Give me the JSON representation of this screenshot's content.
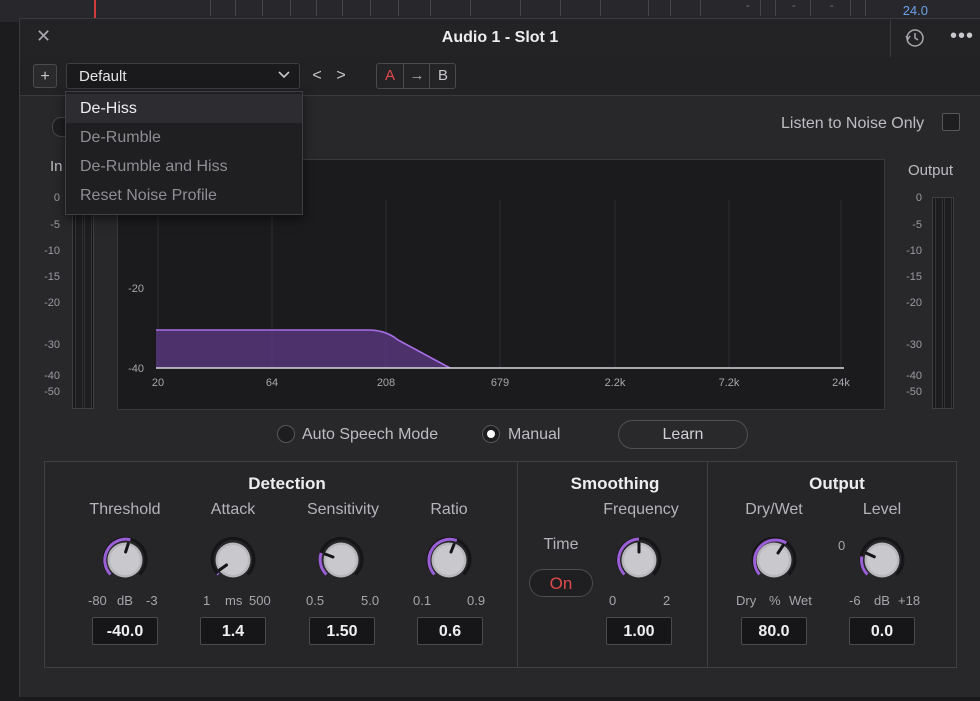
{
  "timeline": {
    "value": "24.0",
    "dashes": [
      "-",
      "-",
      "-"
    ]
  },
  "window": {
    "title": "Audio 1 - Slot 1"
  },
  "toolbar": {
    "add_label": "+",
    "preset": "Default",
    "prev": "<",
    "next": ">",
    "a_label": "A",
    "copy_arrow": "→",
    "b_label": "B"
  },
  "dropdown": {
    "items": [
      "De-Hiss",
      "De-Rumble",
      "De-Rumble and Hiss",
      "Reset Noise Profile"
    ],
    "selected_index": 0
  },
  "input": {
    "label": "In",
    "scale": [
      "0",
      "-5",
      "-10",
      "-15",
      "-20",
      "-30",
      "-40",
      "-50"
    ]
  },
  "output_meter": {
    "label": "Output",
    "scale": [
      "0",
      "-5",
      "-10",
      "-15",
      "-20",
      "-30",
      "-40",
      "-50"
    ]
  },
  "listen": {
    "label": "Listen to Noise Only",
    "checked": false
  },
  "graph": {
    "y_labels": [
      "-20",
      "-40"
    ],
    "x_labels": [
      "20",
      "64",
      "208",
      "679",
      "2.2k",
      "7.2k",
      "24k"
    ],
    "curve_color": "#9a5fd6"
  },
  "mode": {
    "auto_label": "Auto Speech Mode",
    "manual_label": "Manual",
    "selected": "Manual",
    "learn_label": "Learn"
  },
  "accent_color": "#9a5fd6",
  "toggle_on_color": "#e04a4a",
  "detection": {
    "title": "Detection",
    "threshold": {
      "label": "Threshold",
      "min": "-80",
      "unit": "dB",
      "max": "-3",
      "value": "-40.0"
    },
    "attack": {
      "label": "Attack",
      "min": "1",
      "unit": "ms",
      "max": "500",
      "value": "1.4"
    },
    "sensitivity": {
      "label": "Sensitivity",
      "min": "0.5",
      "max": "5.0",
      "value": "1.50"
    },
    "ratio": {
      "label": "Ratio",
      "min": "0.1",
      "max": "0.9",
      "value": "0.6"
    }
  },
  "smoothing": {
    "title": "Smoothing",
    "time_label": "Time",
    "time_toggle": "On",
    "frequency": {
      "label": "Frequency",
      "min": "0",
      "max": "2",
      "value": "1.00"
    }
  },
  "output": {
    "title": "Output",
    "drywet": {
      "label": "Dry/Wet",
      "min": "Dry",
      "unit": "%",
      "max": "Wet",
      "value": "80.0"
    },
    "level": {
      "label": "Level",
      "zero": "0",
      "min": "-6",
      "unit": "dB",
      "max": "+18",
      "value": "0.0"
    }
  }
}
